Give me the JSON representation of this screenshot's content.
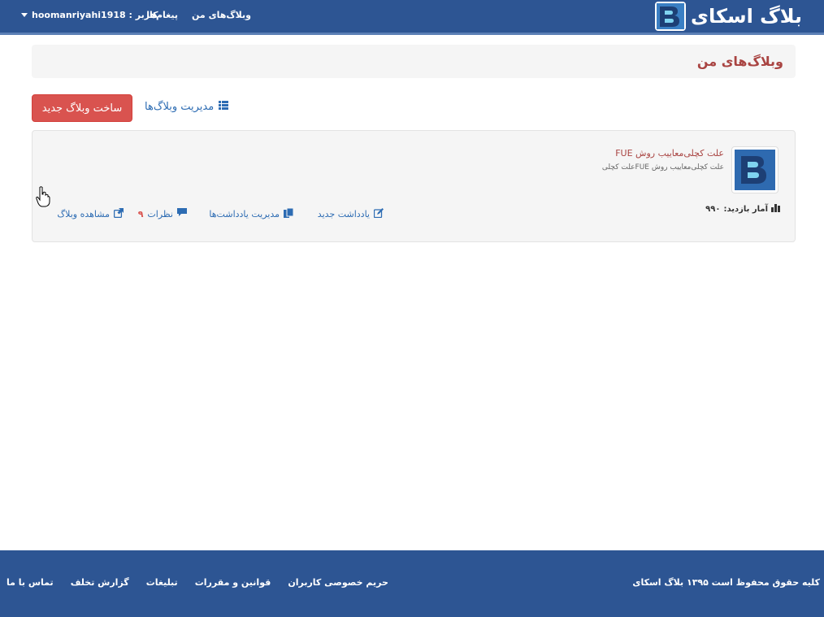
{
  "navbar": {
    "brand": "بلاگ اسکای",
    "my_blogs": "وبلاگ‌های من",
    "messages": "پیغام‌ها",
    "user": "کاربر : hoomanriyahi1918"
  },
  "page": {
    "title": "وبلاگ‌های من",
    "new_blog_button": "ساخت وبلاگ جدید",
    "manage_blogs_link": "مدیریت وبلاگ‌ها"
  },
  "blog": {
    "title": "علت کچلی‌معاییب روش FUE",
    "description": "علت کچلی‌معاییب روش FUEعلت کچلی",
    "stats_label": "آمار بازدید:",
    "stats_value": "۹۹۰",
    "actions": {
      "new_post": "یادداشت جدید",
      "manage_posts": "مدیریت یادداشت‌ها",
      "comments": "نظرات",
      "comments_count": "۹",
      "view_blog": "مشاهده وبلاگ"
    }
  },
  "footer": {
    "copyright": "کلیه حقوق محفوظ است ۱۳۹۵ بلاگ اسکای",
    "links": [
      "حریم خصوصی کاربران",
      "قوانین و مقررات",
      "تبلیغات",
      "گزارش تخلف",
      "تماس با ما"
    ]
  },
  "colors": {
    "navbar": "#2d5593",
    "accent_red": "#d9534f",
    "title_red": "#a94442",
    "link_blue": "#2d6cb3"
  },
  "icons": {
    "brand": "blogsky-logo",
    "manage": "list-icon",
    "new_post": "edit-icon",
    "manage_posts": "files-icon",
    "comments": "comment-icon",
    "view": "external-link-icon",
    "stats": "bar-chart-icon",
    "user_menu": "caret-down-icon"
  }
}
